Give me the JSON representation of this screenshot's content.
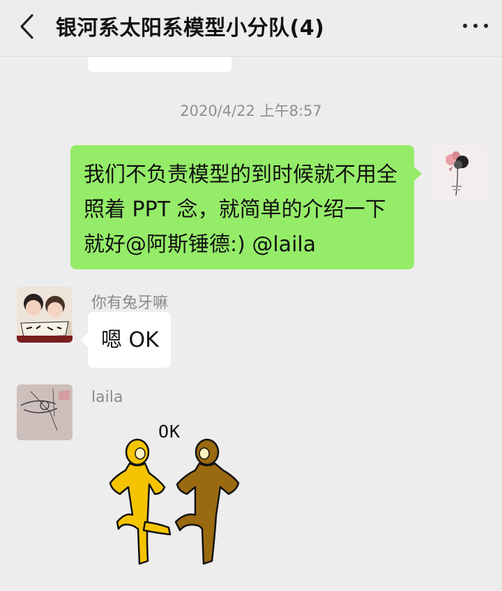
{
  "header": {
    "title": "银河系太阳系模型小分队(4)",
    "back_icon": "chevron-left-icon",
    "more_icon": "more-dots-icon"
  },
  "chat": {
    "timestamp": "2020/4/22 上午8:57",
    "messages": [
      {
        "sender": "self",
        "text": "我们不负责模型的到时候就不用全照着 PPT 念，就简单的介绍一下就好@阿斯锤德:) @laila"
      },
      {
        "sender": "你有兔牙嘛",
        "text": "嗯 OK"
      },
      {
        "sender": "laila",
        "sticker_text": "OK"
      }
    ]
  },
  "colors": {
    "background": "#ededed",
    "outgoing_bubble": "#95ec69",
    "incoming_bubble": "#ffffff",
    "sticker_left": "#f5c400",
    "sticker_right": "#9a6a10"
  }
}
